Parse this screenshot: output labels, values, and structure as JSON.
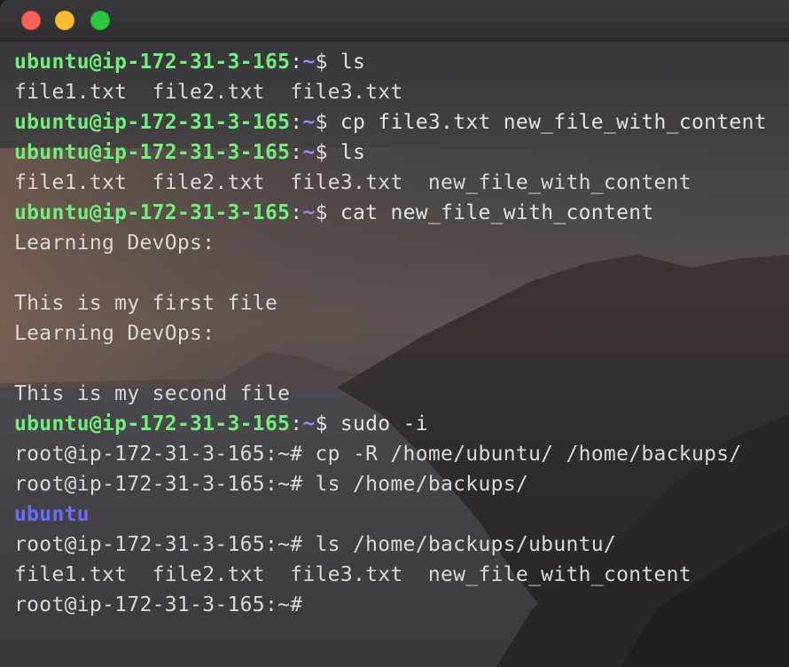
{
  "window": {
    "buttons": [
      "close",
      "minimize",
      "zoom"
    ]
  },
  "terminal": {
    "lines": [
      {
        "type": "user",
        "user": "ubuntu@ip-172-31-3-165",
        "path": "~",
        "prompt": "$",
        "cmd": " ls"
      },
      {
        "type": "out",
        "text": "file1.txt  file2.txt  file3.txt"
      },
      {
        "type": "user",
        "user": "ubuntu@ip-172-31-3-165",
        "path": "~",
        "prompt": "$",
        "cmd": " cp file3.txt new_file_with_content"
      },
      {
        "type": "user",
        "user": "ubuntu@ip-172-31-3-165",
        "path": "~",
        "prompt": "$",
        "cmd": " ls"
      },
      {
        "type": "out",
        "text": "file1.txt  file2.txt  file3.txt  new_file_with_content"
      },
      {
        "type": "user",
        "user": "ubuntu@ip-172-31-3-165",
        "path": "~",
        "prompt": "$",
        "cmd": " cat new_file_with_content"
      },
      {
        "type": "out",
        "text": "Learning DevOps:"
      },
      {
        "type": "out",
        "text": ""
      },
      {
        "type": "out",
        "text": "This is my first file"
      },
      {
        "type": "out",
        "text": "Learning DevOps:"
      },
      {
        "type": "out",
        "text": ""
      },
      {
        "type": "out",
        "text": "This is my second file"
      },
      {
        "type": "user",
        "user": "ubuntu@ip-172-31-3-165",
        "path": "~",
        "prompt": "$",
        "cmd": " sudo -i"
      },
      {
        "type": "root",
        "text": "root@ip-172-31-3-165:~# cp -R /home/ubuntu/ /home/backups/"
      },
      {
        "type": "root",
        "text": "root@ip-172-31-3-165:~# ls /home/backups/"
      },
      {
        "type": "dir",
        "text": "ubuntu"
      },
      {
        "type": "root",
        "text": "root@ip-172-31-3-165:~# ls /home/backups/ubuntu/"
      },
      {
        "type": "out",
        "text": "file1.txt  file2.txt  file3.txt  new_file_with_content"
      },
      {
        "type": "root",
        "text": "root@ip-172-31-3-165:~#"
      }
    ]
  },
  "colors": {
    "user": "#6ff07a",
    "path": "#8a90ff",
    "dir": "#6b6cff",
    "text": "#dadada"
  }
}
